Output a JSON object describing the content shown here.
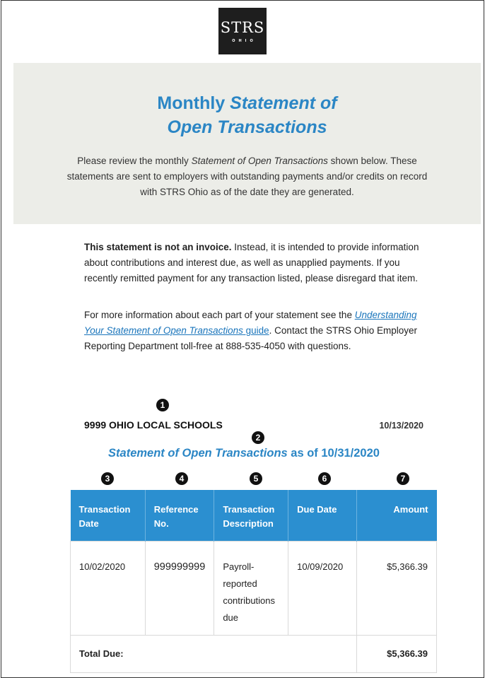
{
  "logo": {
    "mark": "STRS",
    "sub": "OHIO"
  },
  "banner": {
    "title_line1_plain": "Monthly ",
    "title_line1_em": "Statement of",
    "title_line2_em": "Open Transactions",
    "intro_1": "Please review the monthly ",
    "intro_em": "Statement of Open Transactions",
    "intro_2": " shown below. These statements are sent to employers with outstanding payments and/or credits on record with STRS Ohio as of the date they are generated."
  },
  "notice": {
    "bold": "This statement is not an invoice.",
    "rest": " Instead, it is intended to provide information about contributions and interest due, as well as unapplied payments. If you recently remitted payment for any transaction listed, please disregard that item."
  },
  "more_info": {
    "before": "For more information about each part of your statement see the ",
    "link": "Understanding Your Statement of Open Transactions",
    "link_suffix": " guide",
    "after": ". Contact the STRS Ohio Employer Reporting Department toll-free at 888-535-4050 with questions."
  },
  "markers": [
    "1",
    "2",
    "3",
    "4",
    "5",
    "6",
    "7"
  ],
  "employer": {
    "name": "9999 OHIO LOCAL SCHOOLS",
    "date": "10/13/2020"
  },
  "statement": {
    "title_em": "Statement of Open Transactions",
    "title_rest": " as of 10/31/2020"
  },
  "table": {
    "headers": [
      "Transaction Date",
      "Reference No.",
      "Transaction Description",
      "Due Date",
      "Amount"
    ],
    "rows": [
      {
        "date": "10/02/2020",
        "ref": "999999999",
        "desc": "Payroll-reported contributions due",
        "due": "10/09/2020",
        "amount": "$5,366.39"
      }
    ],
    "total_label": "Total Due:",
    "total_amount": "$5,366.39"
  }
}
